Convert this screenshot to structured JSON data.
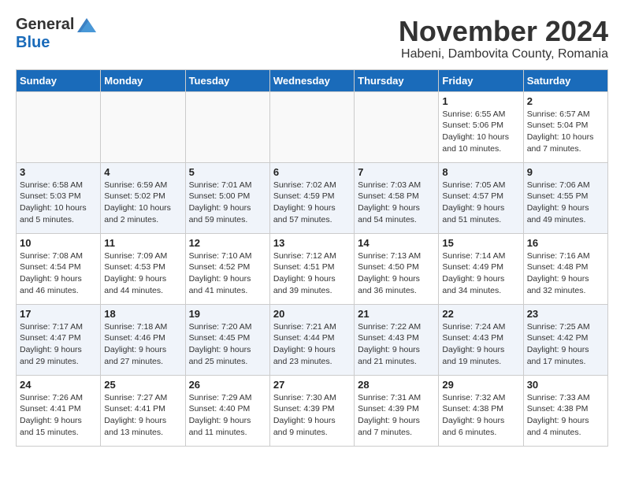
{
  "header": {
    "logo_general": "General",
    "logo_blue": "Blue",
    "month_title": "November 2024",
    "location": "Habeni, Dambovita County, Romania"
  },
  "weekdays": [
    "Sunday",
    "Monday",
    "Tuesday",
    "Wednesday",
    "Thursday",
    "Friday",
    "Saturday"
  ],
  "weeks": [
    [
      {
        "day": "",
        "info": ""
      },
      {
        "day": "",
        "info": ""
      },
      {
        "day": "",
        "info": ""
      },
      {
        "day": "",
        "info": ""
      },
      {
        "day": "",
        "info": ""
      },
      {
        "day": "1",
        "info": "Sunrise: 6:55 AM\nSunset: 5:06 PM\nDaylight: 10 hours and 10 minutes."
      },
      {
        "day": "2",
        "info": "Sunrise: 6:57 AM\nSunset: 5:04 PM\nDaylight: 10 hours and 7 minutes."
      }
    ],
    [
      {
        "day": "3",
        "info": "Sunrise: 6:58 AM\nSunset: 5:03 PM\nDaylight: 10 hours and 5 minutes."
      },
      {
        "day": "4",
        "info": "Sunrise: 6:59 AM\nSunset: 5:02 PM\nDaylight: 10 hours and 2 minutes."
      },
      {
        "day": "5",
        "info": "Sunrise: 7:01 AM\nSunset: 5:00 PM\nDaylight: 9 hours and 59 minutes."
      },
      {
        "day": "6",
        "info": "Sunrise: 7:02 AM\nSunset: 4:59 PM\nDaylight: 9 hours and 57 minutes."
      },
      {
        "day": "7",
        "info": "Sunrise: 7:03 AM\nSunset: 4:58 PM\nDaylight: 9 hours and 54 minutes."
      },
      {
        "day": "8",
        "info": "Sunrise: 7:05 AM\nSunset: 4:57 PM\nDaylight: 9 hours and 51 minutes."
      },
      {
        "day": "9",
        "info": "Sunrise: 7:06 AM\nSunset: 4:55 PM\nDaylight: 9 hours and 49 minutes."
      }
    ],
    [
      {
        "day": "10",
        "info": "Sunrise: 7:08 AM\nSunset: 4:54 PM\nDaylight: 9 hours and 46 minutes."
      },
      {
        "day": "11",
        "info": "Sunrise: 7:09 AM\nSunset: 4:53 PM\nDaylight: 9 hours and 44 minutes."
      },
      {
        "day": "12",
        "info": "Sunrise: 7:10 AM\nSunset: 4:52 PM\nDaylight: 9 hours and 41 minutes."
      },
      {
        "day": "13",
        "info": "Sunrise: 7:12 AM\nSunset: 4:51 PM\nDaylight: 9 hours and 39 minutes."
      },
      {
        "day": "14",
        "info": "Sunrise: 7:13 AM\nSunset: 4:50 PM\nDaylight: 9 hours and 36 minutes."
      },
      {
        "day": "15",
        "info": "Sunrise: 7:14 AM\nSunset: 4:49 PM\nDaylight: 9 hours and 34 minutes."
      },
      {
        "day": "16",
        "info": "Sunrise: 7:16 AM\nSunset: 4:48 PM\nDaylight: 9 hours and 32 minutes."
      }
    ],
    [
      {
        "day": "17",
        "info": "Sunrise: 7:17 AM\nSunset: 4:47 PM\nDaylight: 9 hours and 29 minutes."
      },
      {
        "day": "18",
        "info": "Sunrise: 7:18 AM\nSunset: 4:46 PM\nDaylight: 9 hours and 27 minutes."
      },
      {
        "day": "19",
        "info": "Sunrise: 7:20 AM\nSunset: 4:45 PM\nDaylight: 9 hours and 25 minutes."
      },
      {
        "day": "20",
        "info": "Sunrise: 7:21 AM\nSunset: 4:44 PM\nDaylight: 9 hours and 23 minutes."
      },
      {
        "day": "21",
        "info": "Sunrise: 7:22 AM\nSunset: 4:43 PM\nDaylight: 9 hours and 21 minutes."
      },
      {
        "day": "22",
        "info": "Sunrise: 7:24 AM\nSunset: 4:43 PM\nDaylight: 9 hours and 19 minutes."
      },
      {
        "day": "23",
        "info": "Sunrise: 7:25 AM\nSunset: 4:42 PM\nDaylight: 9 hours and 17 minutes."
      }
    ],
    [
      {
        "day": "24",
        "info": "Sunrise: 7:26 AM\nSunset: 4:41 PM\nDaylight: 9 hours and 15 minutes."
      },
      {
        "day": "25",
        "info": "Sunrise: 7:27 AM\nSunset: 4:41 PM\nDaylight: 9 hours and 13 minutes."
      },
      {
        "day": "26",
        "info": "Sunrise: 7:29 AM\nSunset: 4:40 PM\nDaylight: 9 hours and 11 minutes."
      },
      {
        "day": "27",
        "info": "Sunrise: 7:30 AM\nSunset: 4:39 PM\nDaylight: 9 hours and 9 minutes."
      },
      {
        "day": "28",
        "info": "Sunrise: 7:31 AM\nSunset: 4:39 PM\nDaylight: 9 hours and 7 minutes."
      },
      {
        "day": "29",
        "info": "Sunrise: 7:32 AM\nSunset: 4:38 PM\nDaylight: 9 hours and 6 minutes."
      },
      {
        "day": "30",
        "info": "Sunrise: 7:33 AM\nSunset: 4:38 PM\nDaylight: 9 hours and 4 minutes."
      }
    ]
  ]
}
